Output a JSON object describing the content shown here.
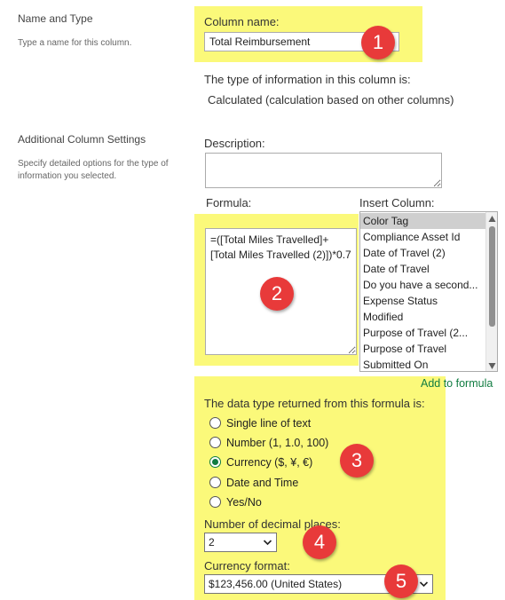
{
  "section_name": {
    "title": "Name and Type",
    "description": "Type a name for this column."
  },
  "column_name": {
    "label": "Column name:",
    "value": "Total Reimbursement"
  },
  "type_info": {
    "label": "The type of information in this column is:",
    "value": "Calculated (calculation based on other columns)"
  },
  "section_additional": {
    "title": "Additional Column Settings",
    "description": "Specify detailed options for the type of information you selected."
  },
  "description_field": {
    "label": "Description:",
    "value": ""
  },
  "formula": {
    "label": "Formula:",
    "value": "=([Total Miles Travelled]+[Total Miles Travelled (2)])*0.7"
  },
  "insert_column": {
    "label": "Insert Column:",
    "items": [
      "Color Tag",
      "Compliance Asset Id",
      "Date of Travel (2)",
      "Date of Travel",
      "Do you have a second...",
      "Expense Status",
      "Modified",
      "Purpose of Travel (2...",
      "Purpose of Travel",
      "Submitted On"
    ],
    "selected_index": 0,
    "add_link": "Add to formula"
  },
  "return_type": {
    "label": "The data type returned from this formula is:",
    "options": [
      "Single line of text",
      "Number (1, 1.0, 100)",
      "Currency ($, ¥, €)",
      "Date and Time",
      "Yes/No"
    ],
    "selected_index": 2
  },
  "decimal_places": {
    "label": "Number of decimal places:",
    "value": "2"
  },
  "currency_format": {
    "label": "Currency format:",
    "value": "$123,456.00 (United States)"
  },
  "badges": [
    "1",
    "2",
    "3",
    "4",
    "5"
  ],
  "colors": {
    "highlight": "#fbf97a",
    "badge": "#e83a3a",
    "accent": "#107c41"
  }
}
